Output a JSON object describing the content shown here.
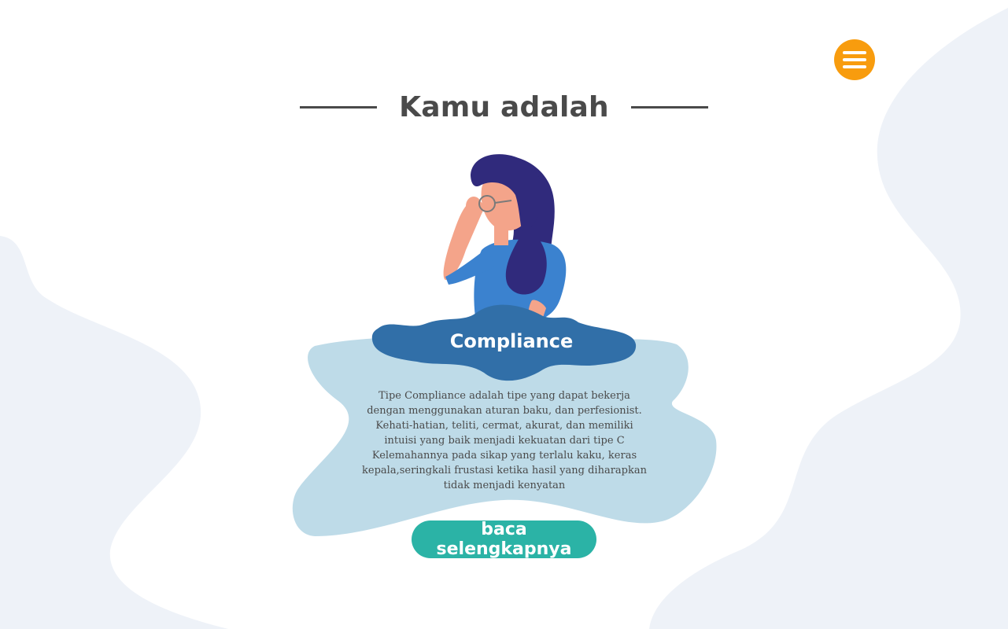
{
  "header": {
    "title": "Kamu adalah"
  },
  "menu": {
    "icon": "hamburger-menu-icon"
  },
  "result": {
    "type_name": "Compliance",
    "description": "Tipe Compliance adalah tipe yang dapat bekerja dengan menggunakan aturan baku, dan perfesionist. Kehati-hatian, teliti, cermat, akurat, dan memiliki intuisi yang baik menjadi kekuatan dari tipe C Kelemahannya pada sikap yang terlalu kaku, keras kepala,seringkali frustasi ketika hasil yang diharapkan tidak menjadi kenyatan"
  },
  "cta": {
    "label": "baca selengkapnya"
  },
  "colors": {
    "accent_orange": "#f89c0e",
    "button_teal": "#2bb3a6",
    "badge_blue": "#316fa8",
    "card_light_blue": "#bedbe8",
    "background_blob": "#eef2f8",
    "text_dark": "#4a4a4a"
  }
}
